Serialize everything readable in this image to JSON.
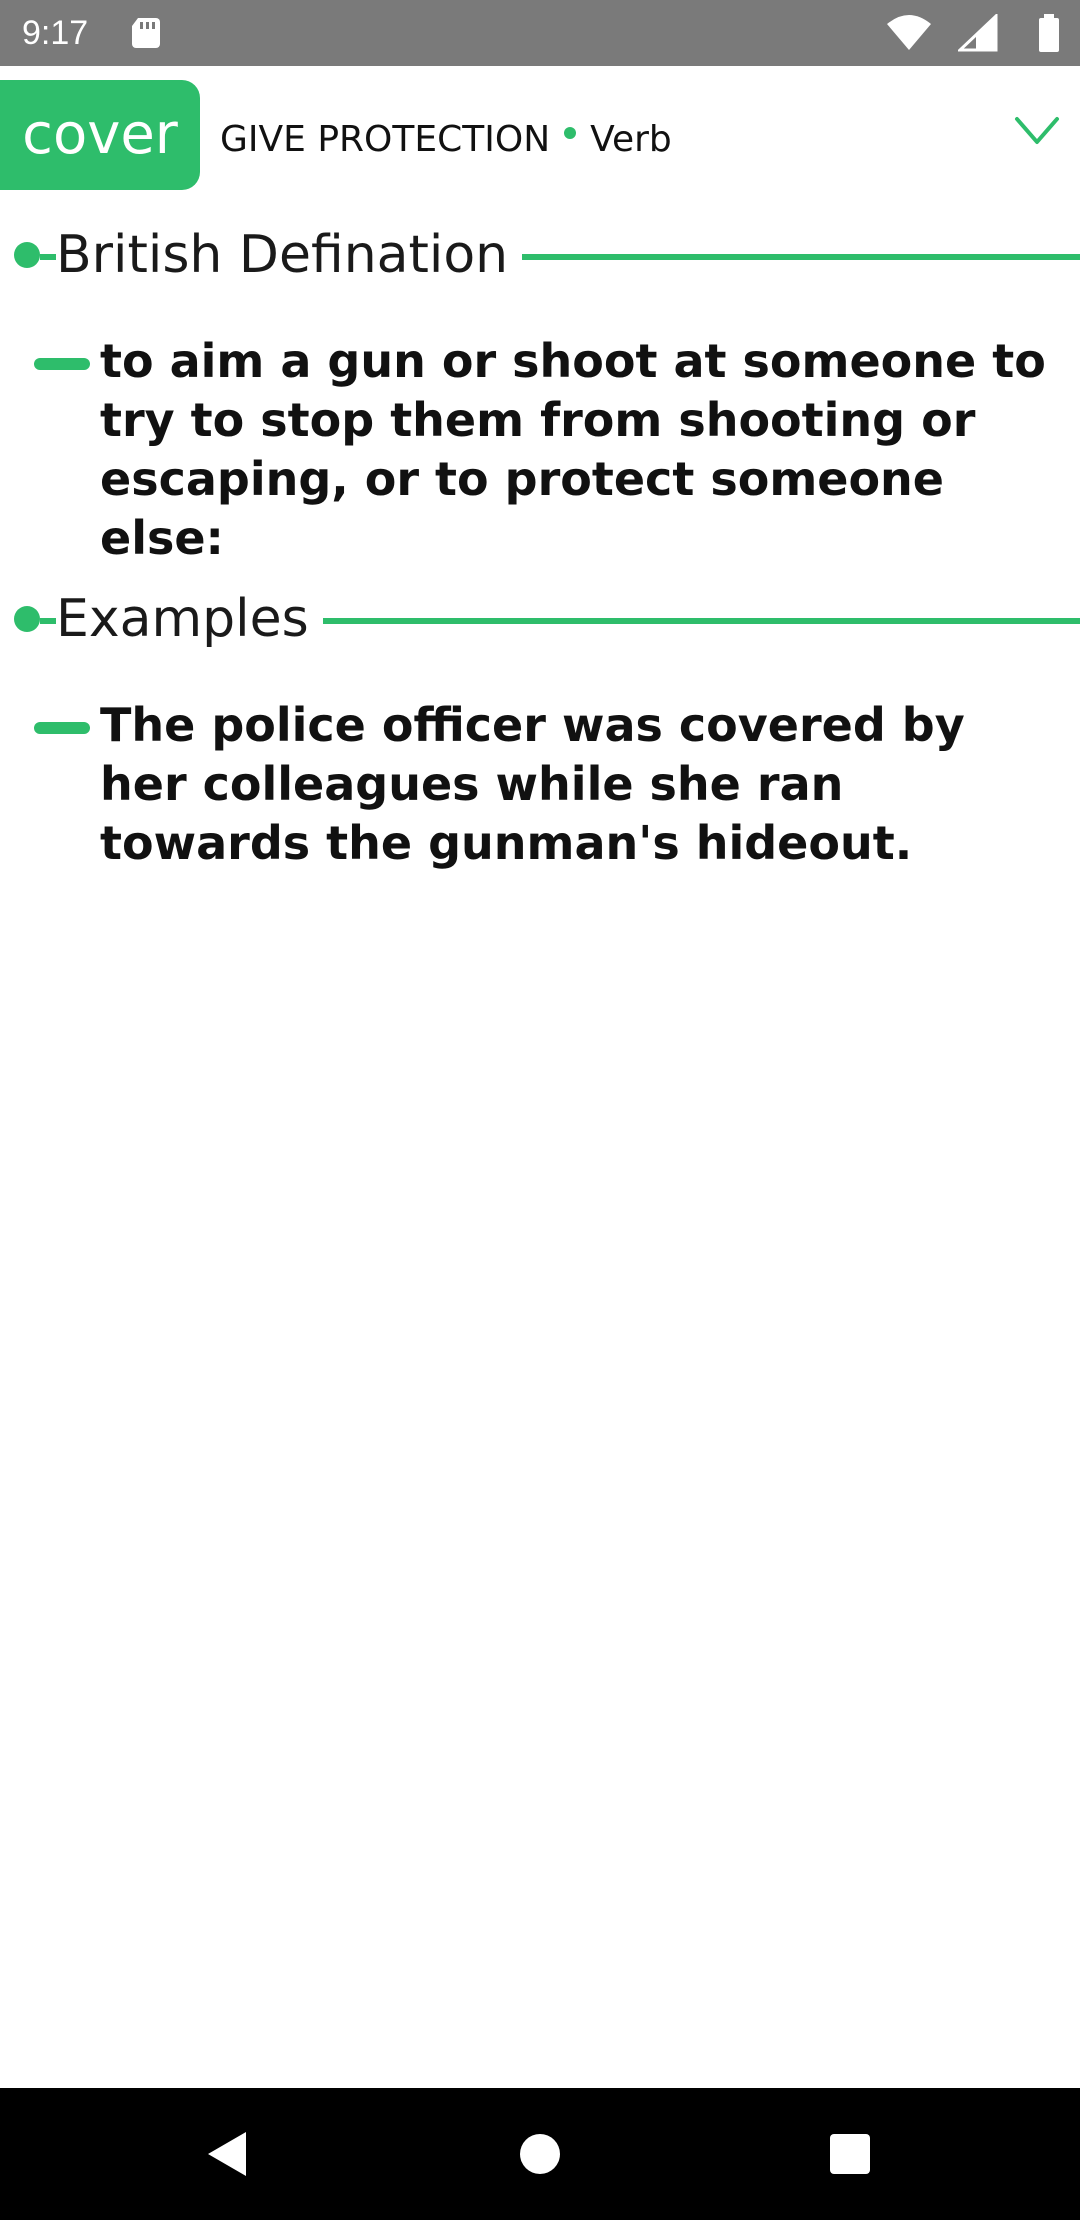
{
  "status_bar": {
    "time": "9:17",
    "icons": [
      "sd-card-icon",
      "wifi-icon",
      "cell-signal-icon",
      "battery-icon"
    ],
    "background": "#7a7a7a"
  },
  "header": {
    "word": "cover",
    "sense": "GIVE PROTECTION",
    "part_of_speech": "Verb",
    "expand_icon": "chevron-down-icon"
  },
  "sections": {
    "definition": {
      "heading": "British Defination",
      "text": "to aim a gun or shoot at someone to try to stop them from shooting or escaping, or to protect someone else:"
    },
    "examples": {
      "heading": "Examples",
      "text": "The police officer was covered by her colleagues while she ran towards the gunman's hideout."
    }
  },
  "nav_bar": {
    "icons": [
      "back-icon",
      "home-icon",
      "recents-icon"
    ]
  },
  "colors": {
    "accent": "#2ebd6b",
    "text": "#111111",
    "background": "#ffffff"
  }
}
